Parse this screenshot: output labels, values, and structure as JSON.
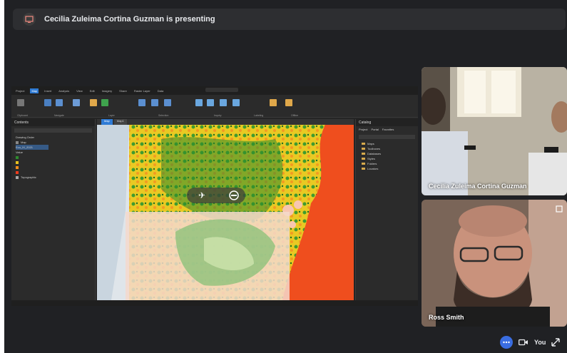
{
  "presenting": {
    "text": "Cecilia Zuleima Cortina Guzman is presenting"
  },
  "shared_screen": {
    "ribbon_tabs": [
      "Project",
      "Map",
      "Insert",
      "Analysis",
      "View",
      "Edit",
      "Imagery",
      "Share",
      "Raster Layer",
      "Data"
    ],
    "active_tab": "Map",
    "ribbon_groups": [
      "Clipboard",
      "Navigate",
      "Layer",
      "Selection",
      "Inquiry",
      "Labeling",
      "Offline"
    ],
    "contents_panel": {
      "title": "Contents",
      "drawing_order_label": "Drawing Order",
      "items": [
        "Map",
        "Eco_IX_2021",
        "Value",
        "Topographic"
      ]
    },
    "map_tabs": [
      "Map",
      "Map1"
    ],
    "catalog_panel": {
      "title": "Catalog",
      "tabs": [
        "Project",
        "Portal",
        "Favorites"
      ],
      "items": [
        "Maps",
        "Toolboxes",
        "Databases",
        "Styles",
        "Folders",
        "Locators"
      ]
    }
  },
  "participants": [
    {
      "name": "Cecilia Zuleima Cortina Guzman"
    },
    {
      "name": "Ross Smith"
    }
  ],
  "controls": {
    "self_label": "You",
    "more_icon": "more-dots-icon",
    "video_icon": "video-camera-icon",
    "expand_icon": "expand-icon"
  },
  "colors": {
    "background": "#202124",
    "accent": "#3a6de1"
  }
}
